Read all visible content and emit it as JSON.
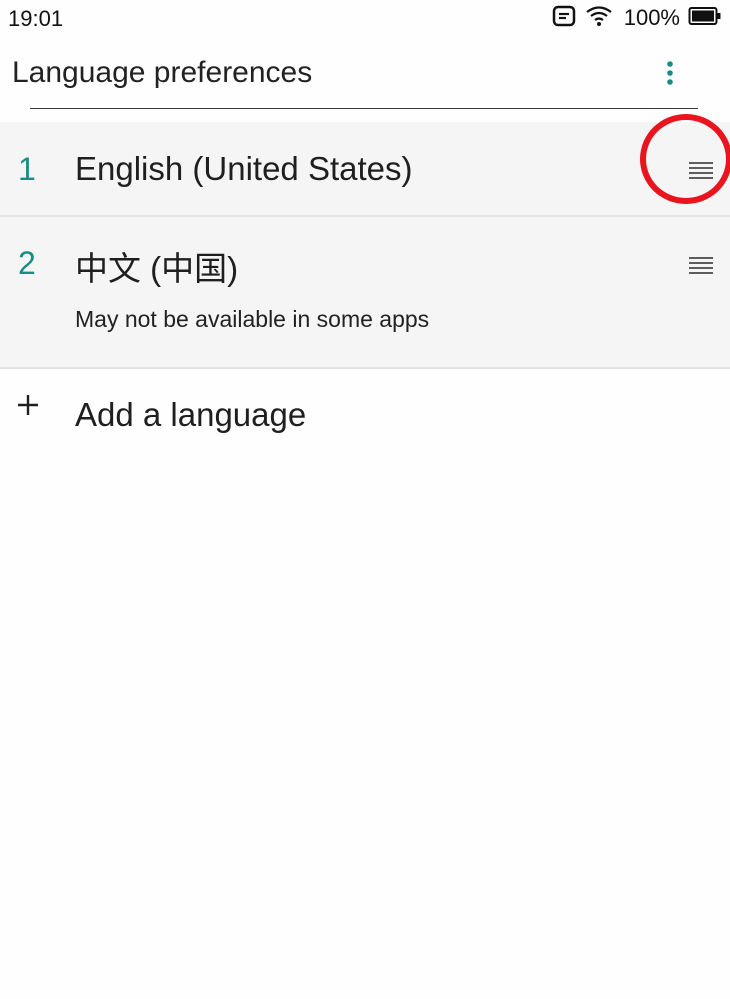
{
  "status_bar": {
    "time": "19:01",
    "battery": "100%",
    "icons": [
      "notification-icon",
      "wifi-icon",
      "battery-icon"
    ]
  },
  "header": {
    "title": "Language preferences",
    "overflow_icon": "more-vert-icon"
  },
  "languages": [
    {
      "index": "1",
      "name": "English (United States)",
      "drag_icon": "drag-handle-icon"
    },
    {
      "index": "2",
      "name": "中文 (中国)",
      "note": "May not be available in some apps",
      "drag_icon": "drag-handle-icon"
    }
  ],
  "actions": {
    "add_language": "Add a language",
    "add_icon": "plus-icon"
  },
  "colors": {
    "accent": "#168e87",
    "highlight": "#e8141e",
    "row_background": "#f5f5f5",
    "page_background": "#fefefe"
  }
}
